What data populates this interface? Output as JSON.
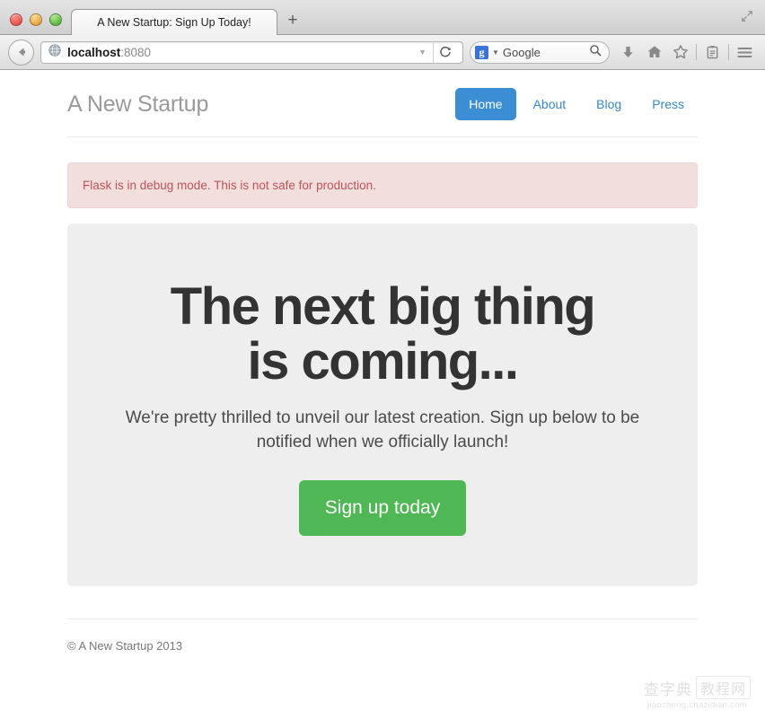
{
  "browser": {
    "window_controls": [
      "close",
      "minimize",
      "maximize"
    ],
    "tab_title": "A New Startup: Sign Up Today!",
    "new_tab_label": "+",
    "back_icon": "back-arrow-icon",
    "url_host": "localhost",
    "url_port": ":8080",
    "url_full": "localhost:8080",
    "site_icon": "globe-icon",
    "dropdown_icon": "chevron-down-icon",
    "reload_icon": "reload-icon",
    "search_engine": "Google",
    "search_engine_badge": "g",
    "search_icon": "magnifier-icon",
    "toolbar_icons": [
      "download-icon",
      "home-icon",
      "bookmark-star-icon",
      "reading-list-icon",
      "hamburger-menu-icon"
    ],
    "expand_icon": "expand-window-icon"
  },
  "site": {
    "brand": "A New Startup",
    "nav": [
      {
        "label": "Home",
        "active": true
      },
      {
        "label": "About",
        "active": false
      },
      {
        "label": "Blog",
        "active": false
      },
      {
        "label": "Press",
        "active": false
      }
    ],
    "alert": {
      "message": "Flask is in debug mode. This is not safe for production.",
      "bg_color": "#f3dede",
      "text_color": "#bb5458",
      "border_color": "#eed3d7"
    },
    "hero": {
      "title_line1": "The next big thing",
      "title_line2": "is coming...",
      "subtitle": "We're pretty thrilled to unveil our latest creation. Sign up below to be notified when we officially launch!",
      "cta_label": "Sign up today",
      "cta_color": "#4fb754",
      "panel_color": "#eeeeee"
    },
    "footer": {
      "copyright": "© A New Startup 2013"
    },
    "accent_color": "#3c8ed4"
  },
  "watermark": {
    "logo_left": "查字典",
    "logo_right": "教程网",
    "domain": "jiaocheng.chazidian.com"
  }
}
